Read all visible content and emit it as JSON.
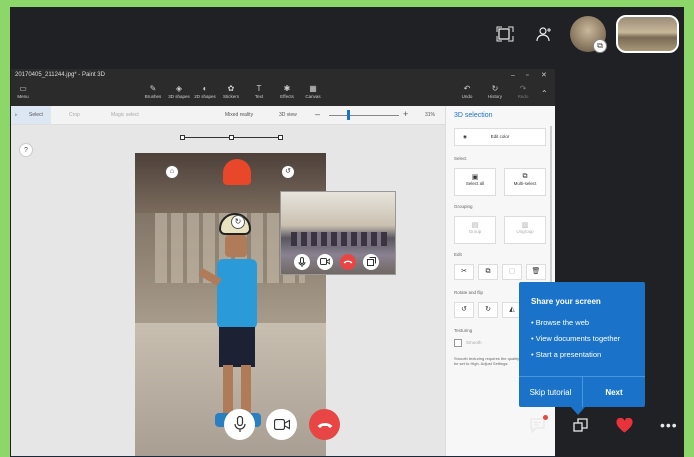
{
  "topbar": {
    "screen_icon": "screen-select-icon",
    "add_person_icon": "add-person-icon",
    "share_badge_icon": "share-screen-badge-icon"
  },
  "paint": {
    "window_title": "20170405_211244.jpg* - Paint 3D",
    "window_controls": [
      "–",
      "▫",
      "✕"
    ],
    "ribbon": {
      "menu": "Menu",
      "brushes": "Brushes",
      "shapes_3d": "3D shapes",
      "shapes_2d": "2D shapes",
      "stickers": "Stickers",
      "text": "Text",
      "effects": "Effects",
      "canvas": "Canvas",
      "undo": "Undo",
      "history": "History",
      "redo": "Redo"
    },
    "toolstrip": {
      "select": "Select",
      "crop": "Crop",
      "magic_select": "Magic select",
      "mixed_reality": "Mixed reality",
      "view_3d": "3D view",
      "zoom": "31%"
    },
    "help": "?",
    "side_panel": {
      "title": "3D selection",
      "edit_color": "Edit color",
      "select_header": "Select",
      "select_all": "Select all",
      "multi_select": "Multi-select",
      "grouping_header": "Grouping",
      "group": "Group",
      "ungroup": "Ungroup",
      "edit_header": "Edit",
      "rotate_header": "Rotate and flip",
      "texturing_header": "Texturing",
      "smooth": "Smooth",
      "smooth_desc": "Smooth texturing requires the quality to be set to High. Adjust Settings."
    }
  },
  "call": {
    "tooltip": {
      "title": "Share your screen",
      "items": [
        "• Browse the web",
        "• View documents together",
        "• Start a presentation"
      ],
      "skip": "Skip tutorial",
      "next": "Next"
    }
  },
  "colors": {
    "accent": "#1a73c8",
    "end_call": "#e84545",
    "heart": "#e8323c",
    "frame_bg": "#202124",
    "border": "#8cd66a"
  }
}
